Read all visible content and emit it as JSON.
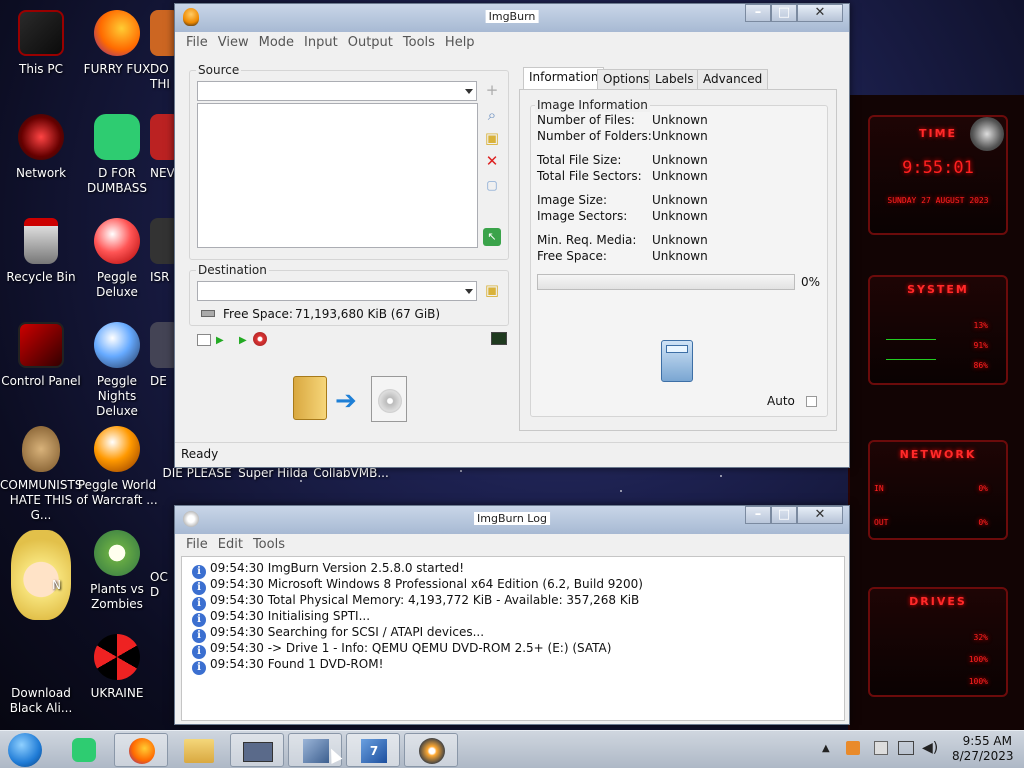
{
  "desktop": {
    "icons": [
      {
        "label": "This PC"
      },
      {
        "label": "FURRY FUX"
      },
      {
        "label": "DO THI"
      },
      {
        "label": "Network"
      },
      {
        "label": "D FOR DUMBASS"
      },
      {
        "label": "NEV"
      },
      {
        "label": "Recycle Bin"
      },
      {
        "label": "Peggle Deluxe"
      },
      {
        "label": "ISR"
      },
      {
        "label": "Control Panel"
      },
      {
        "label": "Peggle Nights Deluxe"
      },
      {
        "label": "DE"
      },
      {
        "label": "COMMUNISTS HATE THIS G..."
      },
      {
        "label": "Peggle World of Warcraft ..."
      },
      {
        "label": "DIE PLEASE"
      },
      {
        "label": "Super Hilda"
      },
      {
        "label": "CollabVMB..."
      },
      {
        "label": "N"
      },
      {
        "label": "Plants vs Zombies"
      },
      {
        "label": "OC D"
      },
      {
        "label": "Download Black Ali..."
      },
      {
        "label": "UKRAINE"
      }
    ]
  },
  "widget": {
    "time_title": "TIME",
    "time": "9:55:01",
    "date": "SUNDAY 27 AUGUST 2023",
    "system_title": "SYSTEM",
    "sys_vals": [
      "13%",
      "91%",
      "86%"
    ],
    "network_title": "NETWORK",
    "net_in": "IN",
    "net_out": "OUT",
    "net_vals": [
      "0%",
      "0%"
    ],
    "drives_title": "DRIVES",
    "drive_vals": [
      "32%",
      "100%",
      "100%"
    ],
    "accent": "#ff2020"
  },
  "imgburn": {
    "title": "ImgBurn",
    "menu": [
      "File",
      "View",
      "Mode",
      "Input",
      "Output",
      "Tools",
      "Help"
    ],
    "source_label": "Source",
    "destination_label": "Destination",
    "free_space_label": "Free Space:",
    "free_space_value": "71,193,680 KiB  (67 GiB)",
    "tabs": [
      "Information",
      "Options",
      "Labels",
      "Advanced"
    ],
    "active_tab": "Information",
    "image_info_label": "Image Information",
    "info_rows": [
      {
        "k": "Number of Files:",
        "v": "Unknown"
      },
      {
        "k": "Number of Folders:",
        "v": "Unknown"
      },
      {
        "k": "Total File Size:",
        "v": "Unknown"
      },
      {
        "k": "Total File Sectors:",
        "v": "Unknown"
      },
      {
        "k": "Image Size:",
        "v": "Unknown"
      },
      {
        "k": "Image Sectors:",
        "v": "Unknown"
      },
      {
        "k": "Min. Req. Media:",
        "v": "Unknown"
      },
      {
        "k": "Free Space:",
        "v": "Unknown"
      }
    ],
    "progress_percent": "0%",
    "progress_fraction": 0,
    "auto_label": "Auto",
    "status": "Ready"
  },
  "log": {
    "title": "ImgBurn Log",
    "menu": [
      "File",
      "Edit",
      "Tools"
    ],
    "lines": [
      "09:54:30 ImgBurn Version 2.5.8.0 started!",
      "09:54:30 Microsoft Windows 8 Professional x64 Edition (6.2, Build 9200)",
      "09:54:30 Total Physical Memory: 4,193,772 KiB  -  Available: 357,268 KiB",
      "09:54:30 Initialising SPTI...",
      "09:54:30 Searching for SCSI / ATAPI devices...",
      "09:54:30 -> Drive 1 - Info: QEMU QEMU DVD-ROM 2.5+ (E:) (SATA)",
      "09:54:30 Found 1 DVD-ROM!"
    ]
  },
  "taskbar": {
    "clock_time": "9:55 AM",
    "clock_date": "8/27/2023"
  }
}
